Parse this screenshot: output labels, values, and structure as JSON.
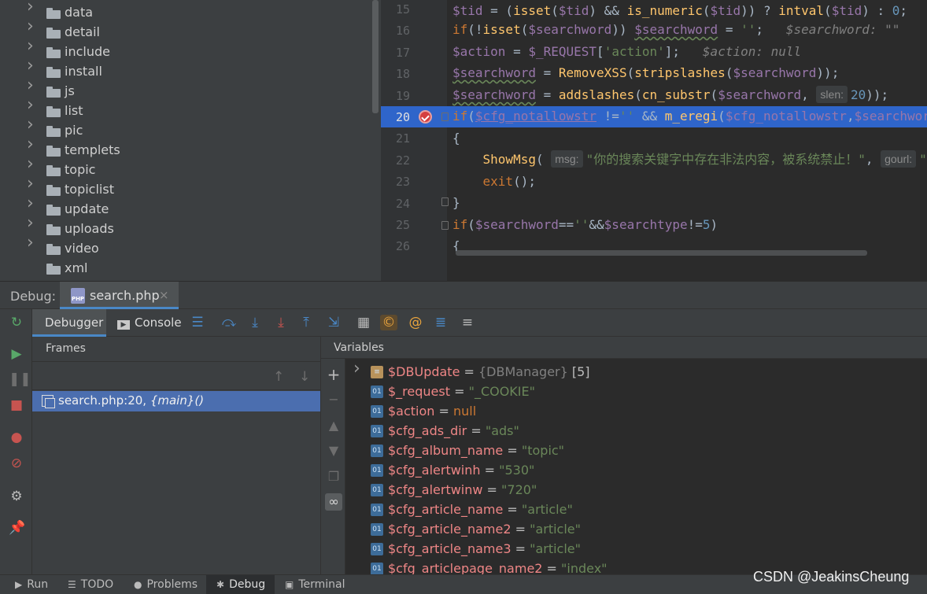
{
  "project_tree": {
    "folders": [
      {
        "name": "data",
        "expandable": true
      },
      {
        "name": "detail",
        "expandable": true
      },
      {
        "name": "include",
        "expandable": true
      },
      {
        "name": "install",
        "expandable": true
      },
      {
        "name": "js",
        "expandable": true
      },
      {
        "name": "list",
        "expandable": true
      },
      {
        "name": "pic",
        "expandable": true
      },
      {
        "name": "templets",
        "expandable": true
      },
      {
        "name": "topic",
        "expandable": true
      },
      {
        "name": "topiclist",
        "expandable": true
      },
      {
        "name": "update",
        "expandable": true
      },
      {
        "name": "uploads",
        "expandable": true
      },
      {
        "name": "video",
        "expandable": true
      },
      {
        "name": "xml",
        "expandable": false
      }
    ]
  },
  "editor": {
    "line_numbers": [
      "15",
      "16",
      "17",
      "18",
      "19",
      "20",
      "21",
      "22",
      "23",
      "24",
      "25",
      "26"
    ],
    "current_line": "20",
    "hints": {
      "searchword_inline": "$searchword: \"\"",
      "action_inline": "$action: null",
      "slen": "slen:",
      "msg": "msg:",
      "gourl": "gourl:"
    },
    "strings": {
      "action_key": "'action'",
      "empty": "''",
      "showmsg_text": "\"你的搜索关键字中存在非法内容，被系统禁止！\""
    }
  },
  "debug_bar": {
    "label": "Debug:",
    "tab_label": "search.php",
    "tab_close": "×",
    "php_icon": "PHP"
  },
  "toolbar": {
    "debugger_tab": "Debugger",
    "console_tab": "Console"
  },
  "frames": {
    "header": "Frames",
    "selected_frame": "search.php:20, ",
    "selected_frame_scope": "{main}()"
  },
  "variables": {
    "header": "Variables",
    "items": [
      {
        "name": "$DBUpdate",
        "eq": " = ",
        "value": "{DBManager} [5]",
        "kind": "object"
      },
      {
        "name": "$_request",
        "eq": " = ",
        "value": "\"_COOKIE\"",
        "kind": "string"
      },
      {
        "name": "$action",
        "eq": " = ",
        "value": "null",
        "kind": "null"
      },
      {
        "name": "$cfg_ads_dir",
        "eq": " = ",
        "value": "\"ads\"",
        "kind": "string"
      },
      {
        "name": "$cfg_album_name",
        "eq": " = ",
        "value": "\"topic\"",
        "kind": "string"
      },
      {
        "name": "$cfg_alertwinh",
        "eq": " = ",
        "value": "\"530\"",
        "kind": "string"
      },
      {
        "name": "$cfg_alertwinw",
        "eq": " = ",
        "value": "\"720\"",
        "kind": "string"
      },
      {
        "name": "$cfg_article_name",
        "eq": " = ",
        "value": "\"article\"",
        "kind": "string"
      },
      {
        "name": "$cfg_article_name2",
        "eq": " = ",
        "value": "\"article\"",
        "kind": "string"
      },
      {
        "name": "$cfg_article_name3",
        "eq": " = ",
        "value": "\"article\"",
        "kind": "string"
      },
      {
        "name": "$cfg_articlepage_name2",
        "eq": " = ",
        "value": "\"index\"",
        "kind": "string"
      }
    ],
    "dbupdate_value": "{DBManager}",
    "dbupdate_count": " [5]",
    "var_icon_label": "01"
  },
  "bottom_tabs": {
    "run": "Run",
    "todo": "TODO",
    "problems": "Problems",
    "debug": "Debug",
    "terminal": "Terminal"
  },
  "watermark": "CSDN @JeakinsCheung",
  "colors": {
    "highlight_line": "#2f65ca",
    "selected_frame": "#4b6eaf",
    "accent_tab": "#4a88c7",
    "breakpoint": "#d53f3f"
  }
}
